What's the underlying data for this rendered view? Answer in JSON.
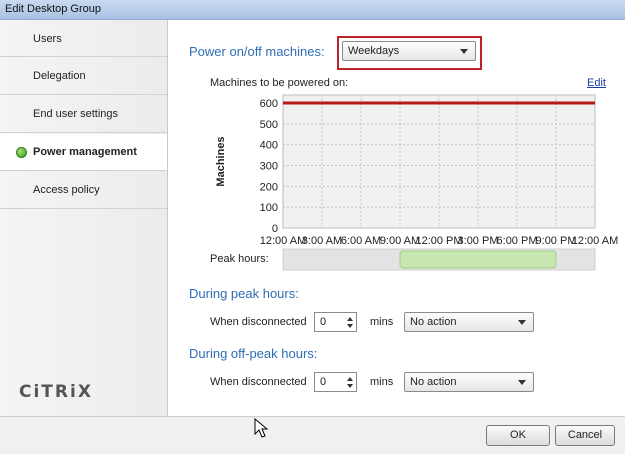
{
  "window": {
    "title": "Edit Desktop Group"
  },
  "sidebar": {
    "items": [
      {
        "label": "Users"
      },
      {
        "label": "Delegation"
      },
      {
        "label": "End user settings"
      },
      {
        "label": "Power management"
      },
      {
        "label": "Access policy"
      }
    ],
    "active_index": 3,
    "logo_text": "CiTRiX"
  },
  "power": {
    "heading": "Power on/off machines:",
    "schedule_value": "Weekdays",
    "chart_label": "Machines to be powered on:",
    "edit_link": "Edit",
    "peak_hours_label": "Peak hours:"
  },
  "chart_data": {
    "type": "line",
    "ylabel": "Machines",
    "xlabel": "",
    "ylim": [
      0,
      600
    ],
    "y_ticks": [
      0,
      100,
      200,
      300,
      400,
      500,
      600
    ],
    "x_ticks": [
      "12:00 AM",
      "3:00 AM",
      "6:00 AM",
      "9:00 AM",
      "12:00 PM",
      "3:00 PM",
      "6:00 PM",
      "9:00 PM",
      "12:00 AM"
    ],
    "series": [
      {
        "values": [
          600,
          600,
          600,
          600,
          600,
          600,
          600,
          600,
          600
        ],
        "color": "#b31b1b"
      }
    ],
    "peak_hours": {
      "start_hour": 9,
      "end_hour": 21,
      "color": "#c8e6b0"
    },
    "grid": true
  },
  "peak": {
    "heading": "During peak hours:",
    "when_label": "When disconnected",
    "minutes_value": "0",
    "mins_label": "mins",
    "action_value": "No action"
  },
  "offpeak": {
    "heading": "During off-peak hours:",
    "when_label": "When disconnected",
    "minutes_value": "0",
    "mins_label": "mins",
    "action_value": "No action"
  },
  "footer": {
    "ok_label": "OK",
    "cancel_label": "Cancel"
  },
  "colors": {
    "accent": "#2f6db4",
    "highlight": "#c0202a"
  }
}
